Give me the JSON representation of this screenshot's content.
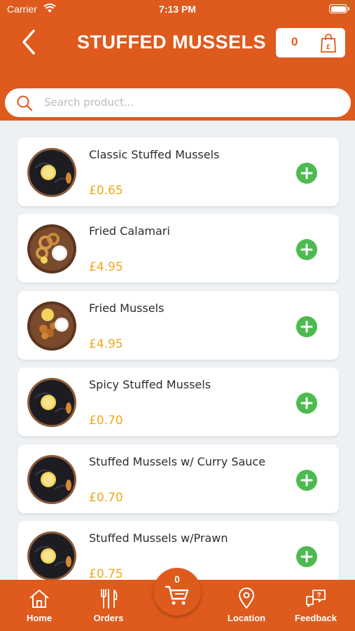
{
  "status_bar": {
    "carrier": "Carrier",
    "time": "7:13 PM"
  },
  "header": {
    "title": "STUFFED MUSSELS",
    "cart_count": "0"
  },
  "search": {
    "placeholder": "Search product..."
  },
  "products": [
    {
      "name": "Classic Stuffed Mussels",
      "price": "£0.65",
      "image": "mussels"
    },
    {
      "name": "Fried Calamari",
      "price": "£4.95",
      "image": "calamari"
    },
    {
      "name": "Fried Mussels",
      "price": "£4.95",
      "image": "fried-mussels"
    },
    {
      "name": "Spicy Stuffed Mussels",
      "price": "£0.70",
      "image": "mussels"
    },
    {
      "name": "Stuffed Mussels w/ Curry Sauce",
      "price": "£0.70",
      "image": "mussels"
    },
    {
      "name": "Stuffed Mussels w/Prawn",
      "price": "£0.75",
      "image": "mussels"
    }
  ],
  "bottom_nav": {
    "items": [
      {
        "label": "Home",
        "icon": "home-icon"
      },
      {
        "label": "Orders",
        "icon": "cutlery-icon"
      },
      {
        "label": "Location",
        "icon": "location-pin-icon"
      },
      {
        "label": "Feedback",
        "icon": "feedback-icon"
      }
    ],
    "cart_count": "0"
  },
  "colors": {
    "brand": "#de5a1d",
    "price": "#f0a81e",
    "add": "#4cbb4f"
  }
}
